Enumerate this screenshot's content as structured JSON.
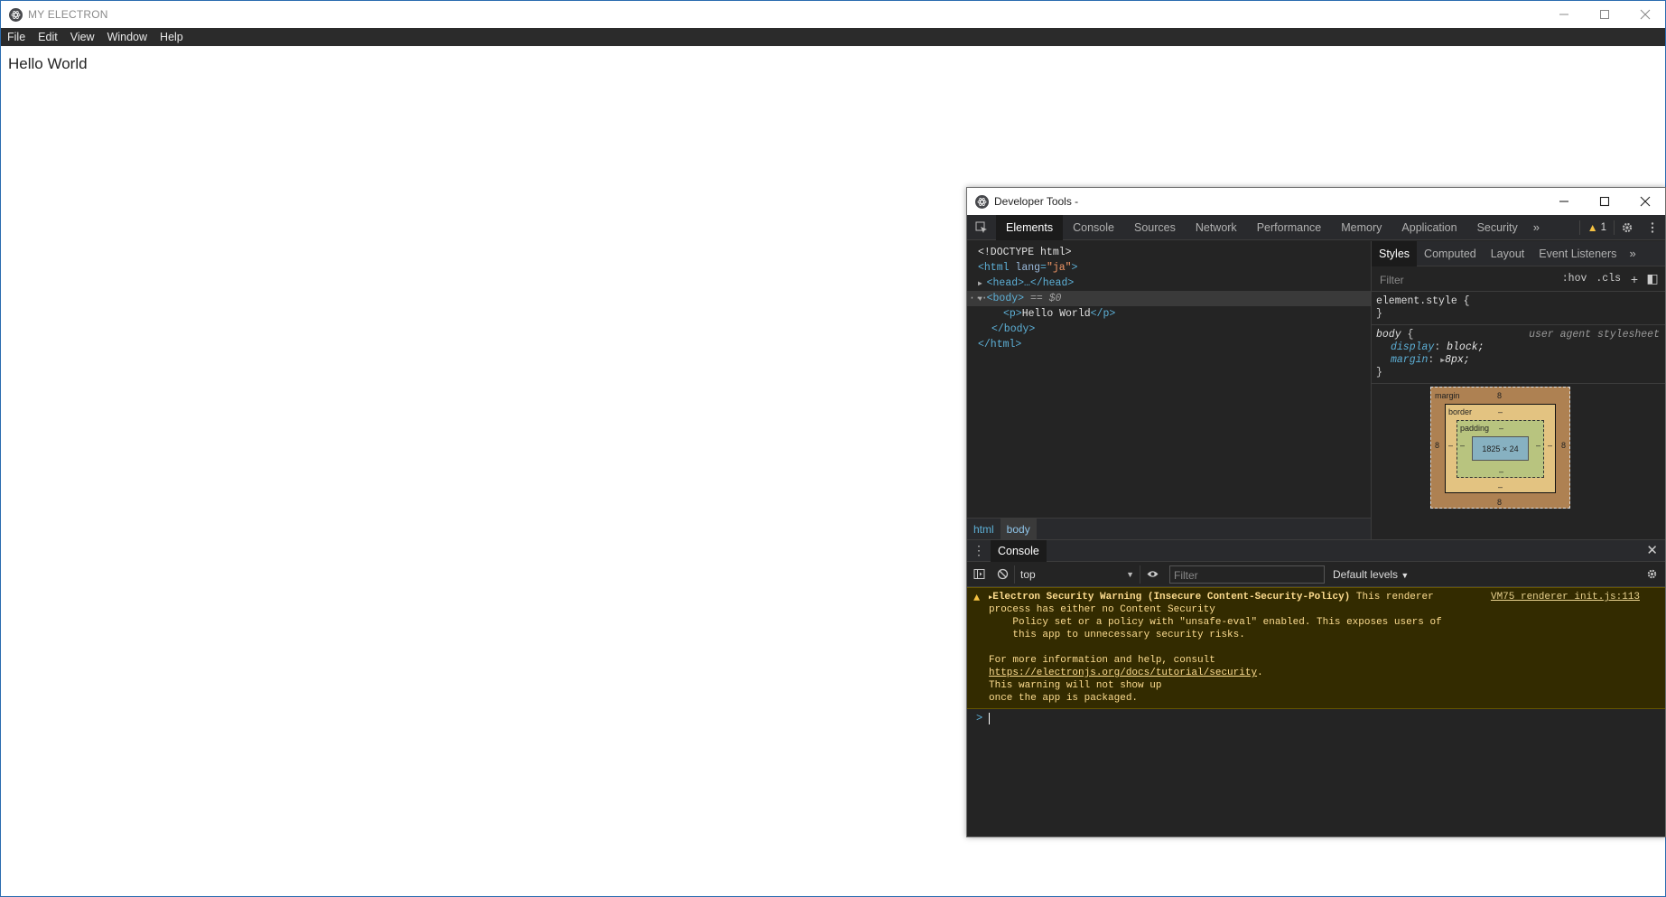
{
  "main_window": {
    "title": "MY ELECTRON",
    "menu": [
      "File",
      "Edit",
      "View",
      "Window",
      "Help"
    ],
    "content_text": "Hello World"
  },
  "devtools": {
    "title": "Developer Tools -",
    "tabs": [
      "Elements",
      "Console",
      "Sources",
      "Network",
      "Performance",
      "Memory",
      "Application",
      "Security"
    ],
    "more_tabs": "»",
    "warning_count": "1",
    "dom": {
      "doctype": "<!DOCTYPE html>",
      "html_open_tag": "<html",
      "lang_attr": "lang",
      "lang_value": "\"ja\"",
      "html_close_bracket": ">",
      "head": "<head>…</head>",
      "body_open": "<body>",
      "body_marker": "== $0",
      "p_open": "<p>",
      "p_text": "Hello World",
      "p_close": "</p>",
      "body_close": "</body>",
      "html_close": "</html>",
      "ellipsis": "···"
    },
    "breadcrumbs": [
      "html",
      "body"
    ],
    "styles_tabs": [
      "Styles",
      "Computed",
      "Layout",
      "Event Listeners"
    ],
    "styles_more": "»",
    "filter_placeholder": "Filter",
    "hov": ":hov",
    "cls": ".cls",
    "rules": {
      "element_style_open": "element.style {",
      "close": "}",
      "body_selector": "body",
      "open_brace": " {",
      "origin": "user agent stylesheet",
      "display_prop": "display",
      "display_val": "block;",
      "margin_prop": "margin",
      "margin_val": "8px;"
    },
    "box_model": {
      "margin_label": "margin",
      "margin_value": "8",
      "border_label": "border",
      "dash": "–",
      "padding_label": "padding",
      "content_size": "1825 × 24"
    },
    "console": {
      "drawer_tab": "Console",
      "context": "top",
      "filter_placeholder": "Filter",
      "levels": "Default levels",
      "warning_lines": [
        "process has either no Content Security",
        "    Policy set or a policy with \"unsafe-eval\" enabled. This exposes users of",
        "    this app to unnecessary security risks.",
        "",
        "For more information and help, consult"
      ],
      "warning_head_bold": "Electron Security Warning (Insecure Content-Security-Policy)",
      "warning_head_rest": " This renderer",
      "warning_link": "https://electronjs.org/docs/tutorial/security",
      "warning_link_suffix": ".",
      "warning_tail": [
        "This warning will not show up",
        "once the app is packaged."
      ],
      "source": "VM75 renderer init.js:113",
      "prompt_symbol": ">"
    }
  }
}
